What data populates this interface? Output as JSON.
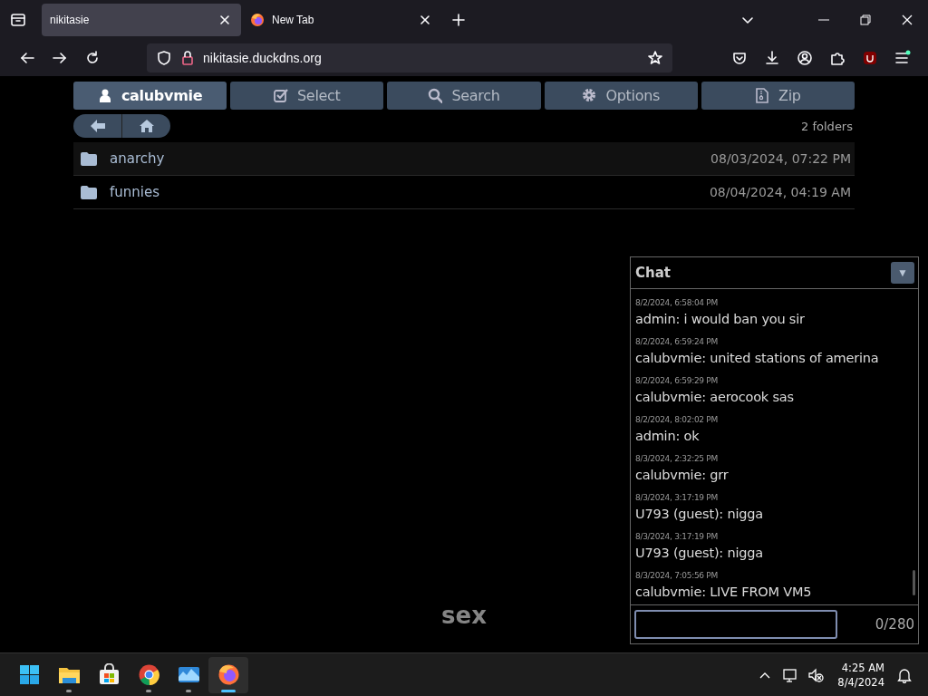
{
  "browser": {
    "tabs": [
      {
        "title": "nikitasie",
        "selected": true,
        "kind": "page"
      },
      {
        "title": "New Tab",
        "selected": false,
        "kind": "firefox"
      }
    ],
    "address": "nikitasie.duckdns.org"
  },
  "toolbar": [
    {
      "label": "calubvmie",
      "selected": true,
      "kind": "user"
    },
    {
      "label": "Select",
      "selected": false,
      "kind": "check"
    },
    {
      "label": "Search",
      "selected": false,
      "kind": "search"
    },
    {
      "label": "Options",
      "selected": false,
      "kind": "gear"
    },
    {
      "label": "Zip",
      "selected": false,
      "kind": "zip"
    }
  ],
  "folder_count": "2 folders",
  "folders": [
    {
      "name": "anarchy",
      "date": "08/03/2024, 07:22 PM",
      "selected": true
    },
    {
      "name": "funnies",
      "date": "08/04/2024, 04:19 AM",
      "selected": false
    }
  ],
  "footer_text": "sex",
  "chat": {
    "title": "Chat",
    "toggle": "▼",
    "messages": [
      {
        "time": "8/2/2024, 6:58:04 PM",
        "text": "admin: i would ban you sir"
      },
      {
        "time": "8/2/2024, 6:59:24 PM",
        "text": "calubvmie: united stations of amerina"
      },
      {
        "time": "8/2/2024, 6:59:29 PM",
        "text": "calubvmie: aerocook sas"
      },
      {
        "time": "8/2/2024, 8:02:02 PM",
        "text": "admin: ok"
      },
      {
        "time": "8/3/2024, 2:32:25 PM",
        "text": "calubvmie: grr"
      },
      {
        "time": "8/3/2024, 3:17:19 PM",
        "text": "U793 (guest): nigga"
      },
      {
        "time": "8/3/2024, 3:17:19 PM",
        "text": "U793 (guest): nigga"
      },
      {
        "time": "8/3/2024, 7:05:56 PM",
        "text": "calubvmie: LIVE FROM VM5"
      }
    ],
    "counter": "0/280"
  },
  "taskbar": {
    "apps": [
      {
        "kind": "start",
        "running": false,
        "selected": false
      },
      {
        "kind": "folder",
        "running": true,
        "selected": false
      },
      {
        "kind": "store",
        "running": false,
        "selected": false
      },
      {
        "kind": "chrome",
        "running": true,
        "selected": false
      },
      {
        "kind": "photos",
        "running": true,
        "selected": false
      },
      {
        "kind": "firefox",
        "running": true,
        "selected": true
      }
    ],
    "time": "4:25 AM",
    "date": "8/4/2024"
  }
}
